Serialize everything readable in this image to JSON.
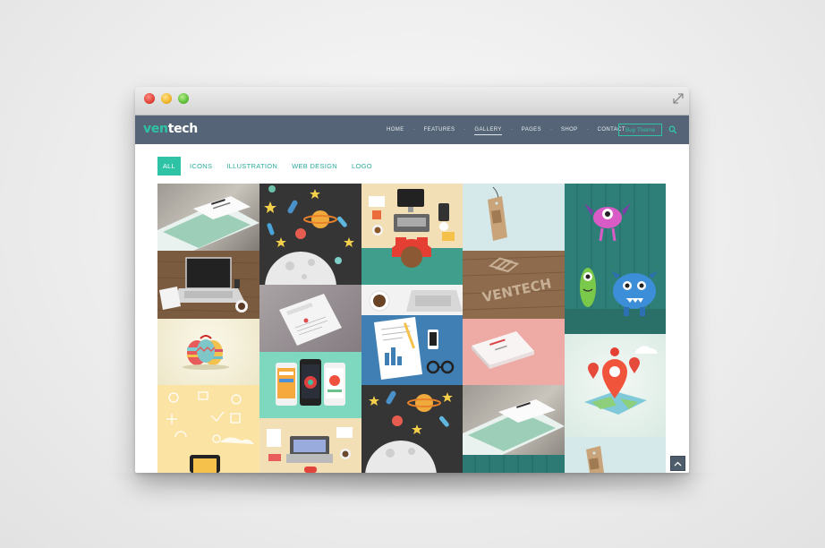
{
  "brand": {
    "logo_prefix": "ven",
    "logo_suffix": "tech"
  },
  "nav": {
    "items": [
      "HOME",
      "FEATURES",
      "GALLERY",
      "PAGES",
      "SHOP",
      "CONTACT"
    ],
    "active": "GALLERY",
    "separator": "-",
    "buy_label": "Buy Theme"
  },
  "filters": {
    "items": [
      "ALL",
      "ICONS",
      "ILLUSTRATION",
      "WEB DESIGN",
      "LOGO"
    ],
    "active": "ALL"
  },
  "gallery": {
    "items": [
      {
        "name": "business-card-mockup"
      },
      {
        "name": "laptop-desk-photo"
      },
      {
        "name": "easter-eggs-photo"
      },
      {
        "name": "flat-icons-illustration"
      },
      {
        "name": "space-rockets-illustration"
      },
      {
        "name": "letterhead-mockup"
      },
      {
        "name": "mobile-app-screens"
      },
      {
        "name": "workspace-top-view"
      },
      {
        "name": "workspace-top-view"
      },
      {
        "name": "office-desk-flat-illustration"
      },
      {
        "name": "space-rockets-illustration"
      },
      {
        "name": "tag-mockup"
      },
      {
        "name": "wooden-logo-mockup"
      },
      {
        "name": "pink-business-card-mockup"
      },
      {
        "name": "business-card-mockup"
      },
      {
        "name": "monsters-illustration"
      },
      {
        "name": "map-pin-illustration"
      },
      {
        "name": "tag-mockup"
      }
    ],
    "logo_text": "VENTECH"
  },
  "colors": {
    "accent": "#2fc3a6",
    "navbar": "#556577"
  }
}
